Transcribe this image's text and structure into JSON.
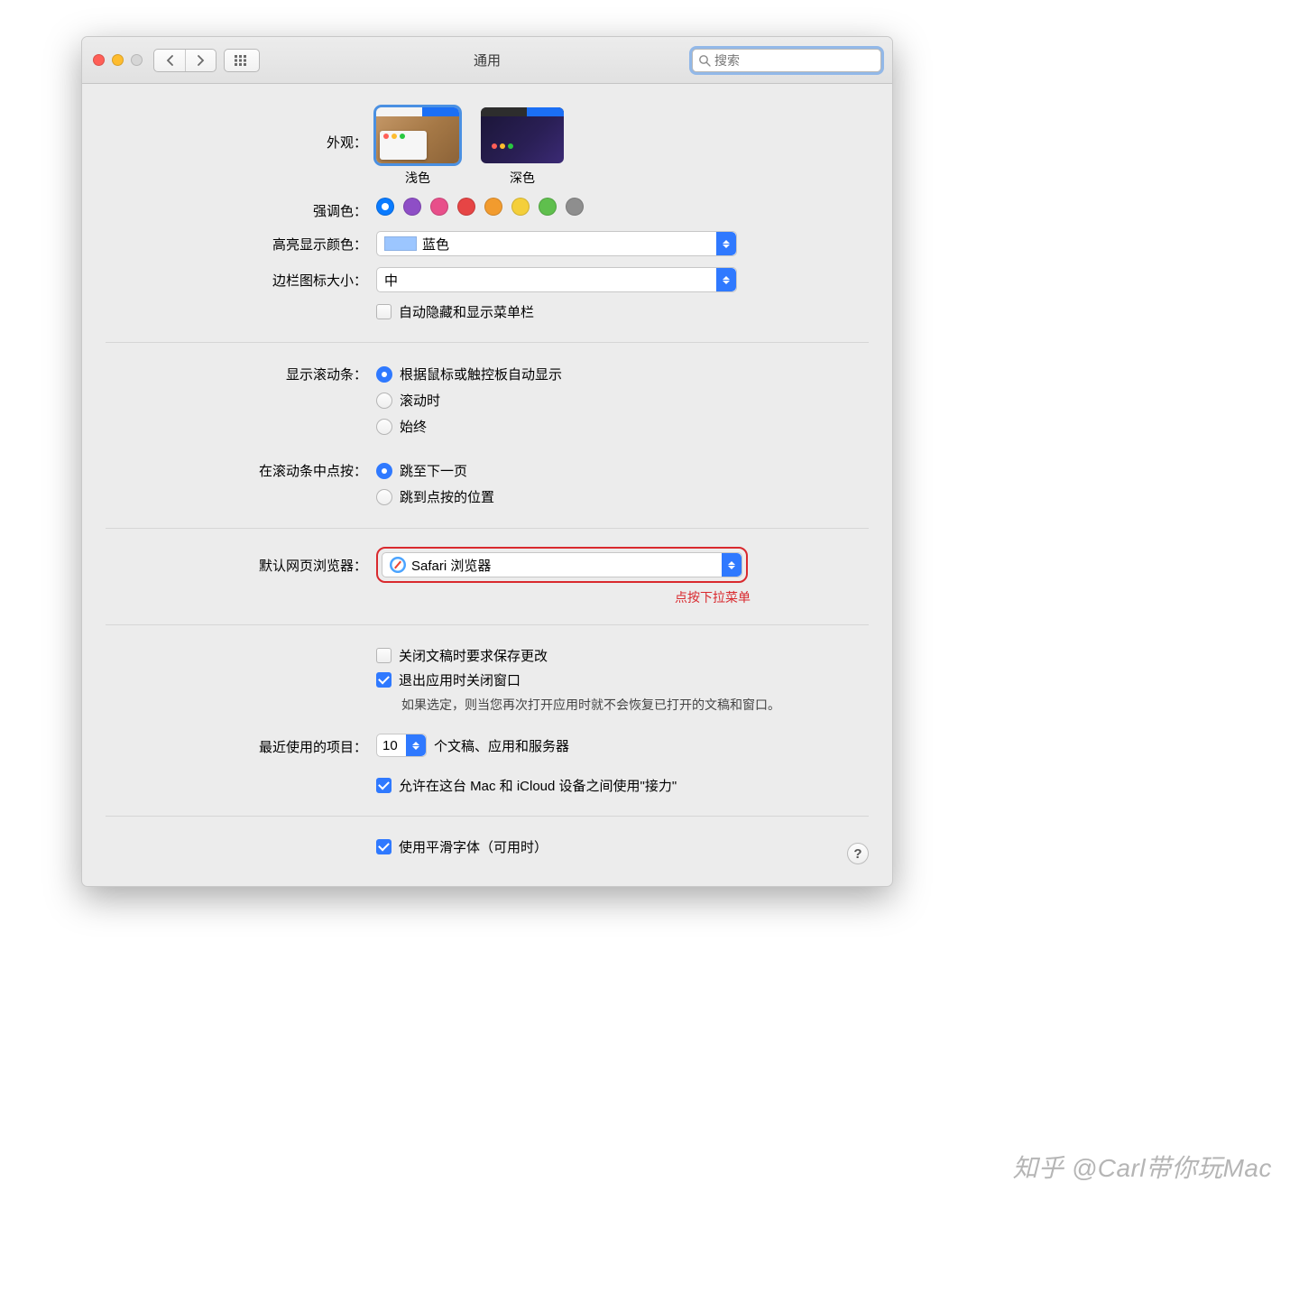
{
  "window": {
    "title": "通用",
    "search_placeholder": "搜索"
  },
  "appearance": {
    "label": "外观：",
    "light": "浅色",
    "dark": "深色"
  },
  "accent": {
    "label": "强调色：",
    "colors": [
      "#0a7bff",
      "#8e4ec6",
      "#e84f8a",
      "#e64545",
      "#f29b2e",
      "#f4cf3a",
      "#5fbf4d",
      "#8e8e8e"
    ],
    "selected_index": 0
  },
  "highlight": {
    "label": "高亮显示颜色：",
    "value": "蓝色"
  },
  "sidebar_size": {
    "label": "边栏图标大小：",
    "value": "中"
  },
  "auto_menubar": {
    "label": "自动隐藏和显示菜单栏"
  },
  "scrollbars": {
    "label": "显示滚动条：",
    "opt1": "根据鼠标或触控板自动显示",
    "opt2": "滚动时",
    "opt3": "始终"
  },
  "scroll_click": {
    "label": "在滚动条中点按：",
    "opt1": "跳至下一页",
    "opt2": "跳到点按的位置"
  },
  "browser": {
    "label": "默认网页浏览器：",
    "value": "Safari 浏览器",
    "annotation": "点按下拉菜单"
  },
  "docs": {
    "ask_save": "关闭文稿时要求保存更改",
    "close_windows": "退出应用时关闭窗口",
    "note": "如果选定，则当您再次打开应用时就不会恢复已打开的文稿和窗口。"
  },
  "recent": {
    "label": "最近使用的项目：",
    "value": "10",
    "suffix": "个文稿、应用和服务器"
  },
  "handoff": {
    "label": "允许在这台 Mac 和 iCloud 设备之间使用\"接力\""
  },
  "font_smoothing": {
    "label": "使用平滑字体（可用时）"
  },
  "help": "?",
  "watermark": "知乎 @Carl带你玩Mac"
}
